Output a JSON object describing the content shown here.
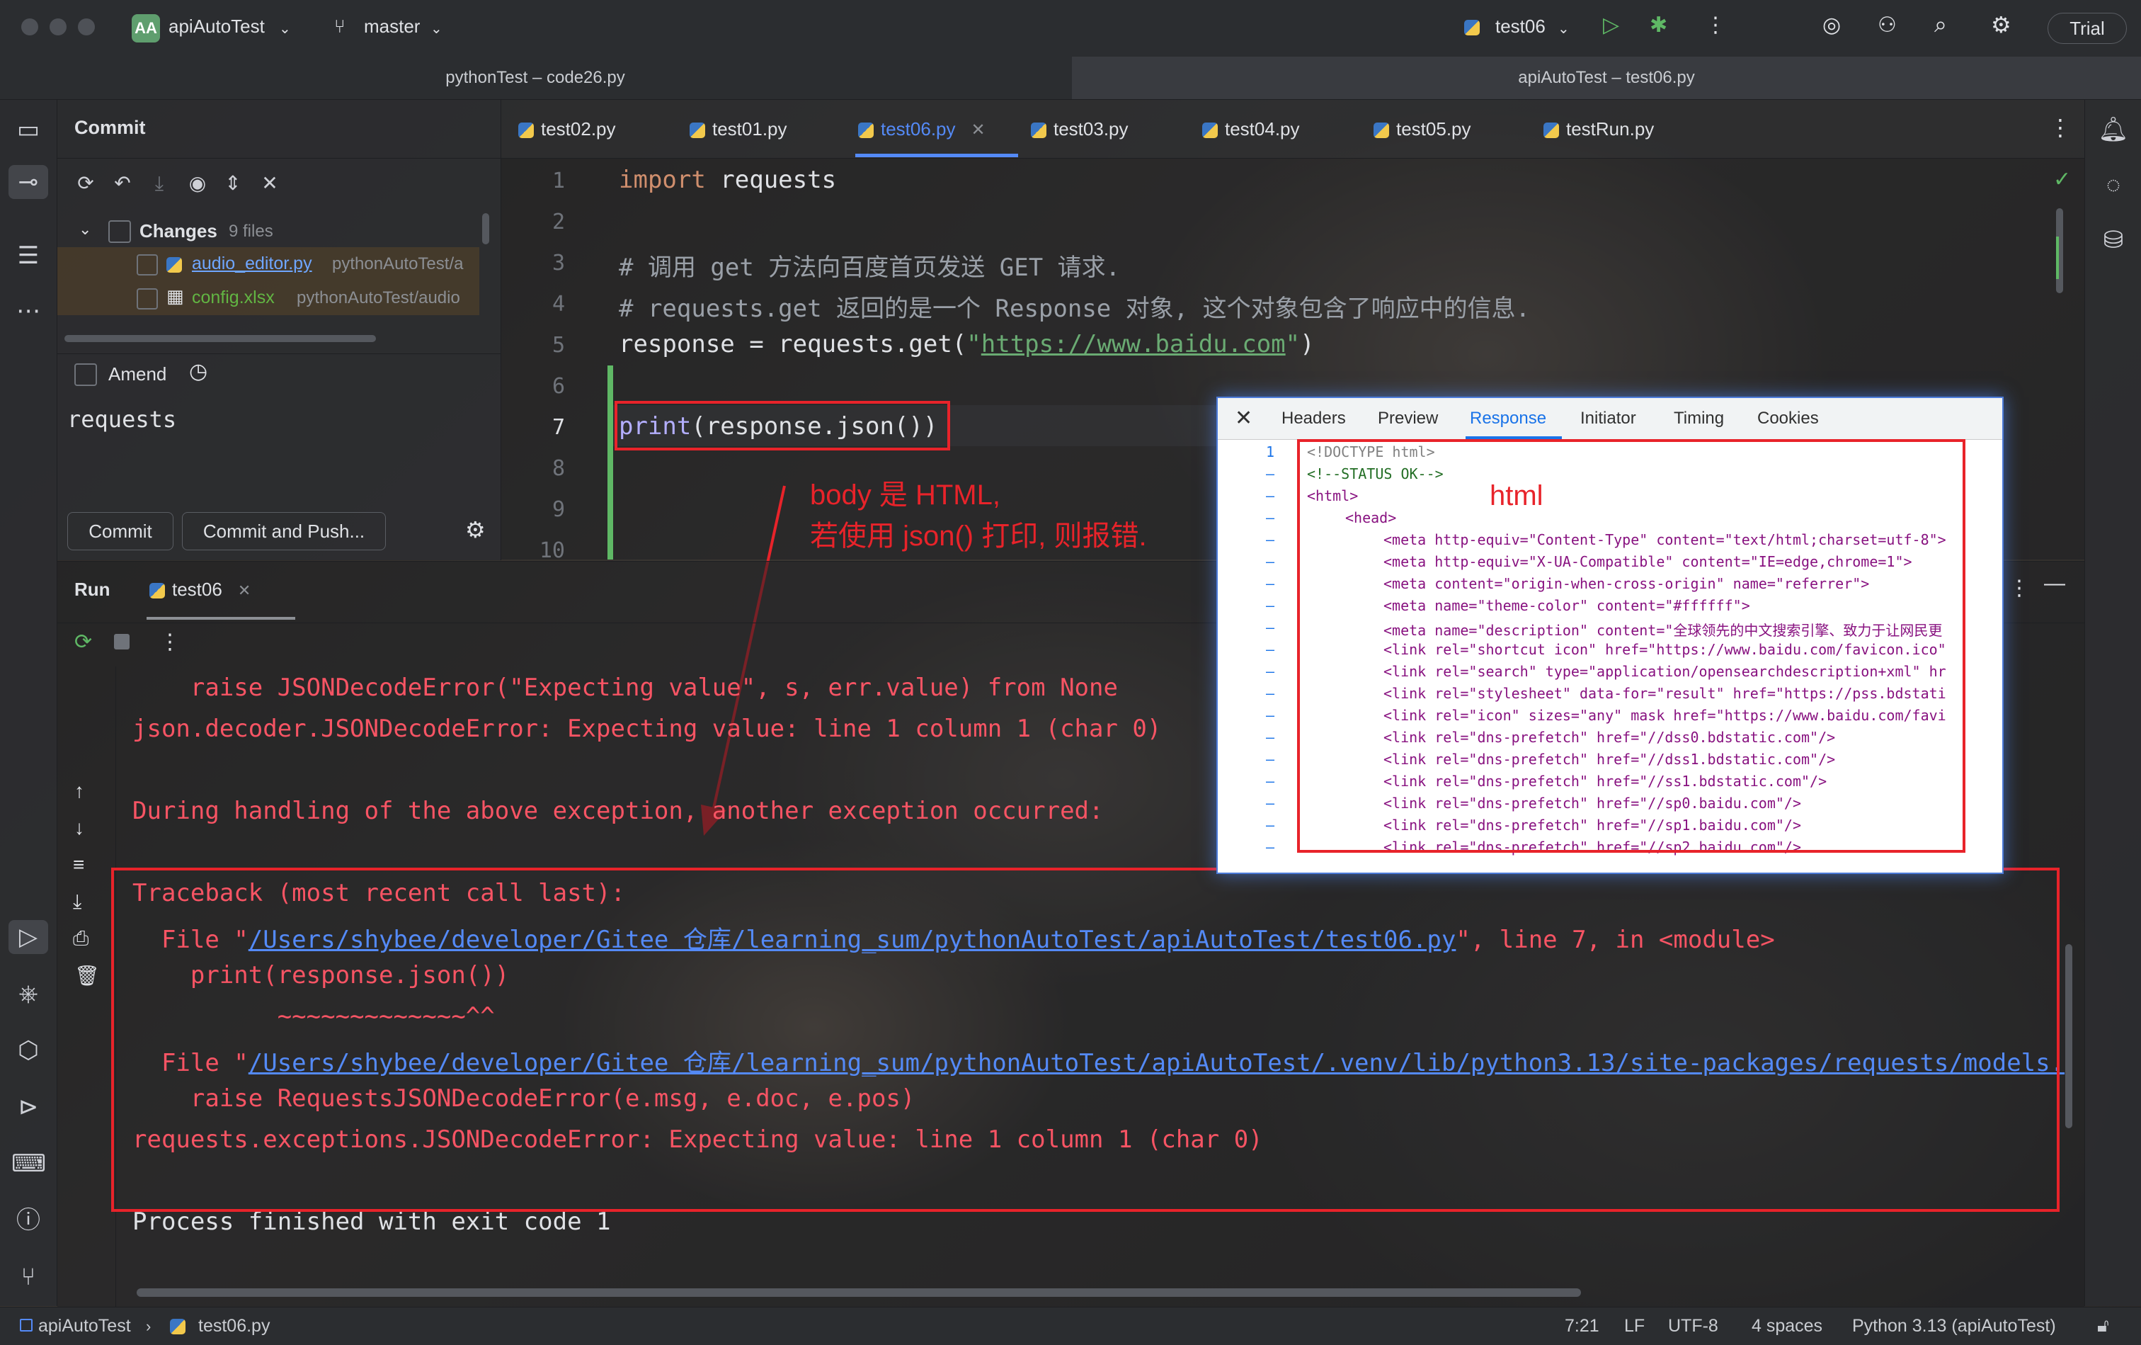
{
  "topbar": {
    "project_badge": "AA",
    "project_name": "apiAutoTest",
    "branch": "master",
    "run_config": "test06",
    "trial_label": "Trial"
  },
  "window_titles": {
    "left": "pythonTest – code26.py",
    "right": "apiAutoTest – test06.py"
  },
  "commit_panel": {
    "title": "Commit",
    "changes_label": "Changes",
    "changes_count": "9 files",
    "files": [
      {
        "name": "audio_editor.py",
        "path": "pythonAutoTest/a"
      },
      {
        "name": "config.xlsx",
        "path": "pythonAutoTest/audio"
      }
    ],
    "amend_label": "Amend",
    "message": "requests",
    "commit_button": "Commit",
    "commit_push_button": "Commit and Push..."
  },
  "editor_tabs": [
    {
      "label": "test02.py"
    },
    {
      "label": "test01.py"
    },
    {
      "label": "test06.py"
    },
    {
      "label": "test03.py"
    },
    {
      "label": "test04.py"
    },
    {
      "label": "test05.py"
    },
    {
      "label": "testRun.py"
    }
  ],
  "editor": {
    "line_numbers": [
      "1",
      "2",
      "3",
      "4",
      "5",
      "6",
      "7",
      "8",
      "9",
      "10"
    ],
    "l1_kw": "import",
    "l1_rest": " requests",
    "l3": "# 调用 get 方法向百度首页发送 GET 请求.",
    "l4": "# requests.get 返回的是一个 Response 对象, 这个对象包含了响应中的信息.",
    "l5_a": "response = requests.get(",
    "l5_q1": "\"",
    "l5_url": "https://www.baidu.com",
    "l5_q2": "\"",
    "l5_b": ")",
    "l7_fn": "print",
    "l7_rest": "(response.json())"
  },
  "annotations": {
    "body_note_1": "body 是 HTML,",
    "body_note_2": "若使用 json() 打印, 则报错.",
    "html_label": "html"
  },
  "run_panel": {
    "title": "Run",
    "tab": "test06",
    "lines": {
      "r1": "    raise JSONDecodeError(\"Expecting value\", s, err.value) from None",
      "r2": "json.decoder.JSONDecodeError: Expecting value: line 1 column 1 (char 0)",
      "r3": "During handling of the above exception, another exception occurred:",
      "r4": "Traceback (most recent call last):",
      "r5_a": "  File \"",
      "r5_link": "/Users/shybee/developer/Gitee 仓库/learning_sum/pythonAutoTest/apiAutoTest/test06.py",
      "r5_b": "\", line 7, in <module>",
      "r6": "    print(response.json())",
      "r7": "          ~~~~~~~~~~~~~^^",
      "r8_a": "  File \"",
      "r8_link": "/Users/shybee/developer/Gitee 仓库/learning_sum/pythonAutoTest/apiAutoTest/.venv/lib/python3.13/site-packages/requests/models.",
      "r9": "    raise RequestsJSONDecodeError(e.msg, e.doc, e.pos)",
      "r10": "requests.exceptions.JSONDecodeError: Expecting value: line 1 column 1 (char 0)",
      "r11": "Process finished with exit code 1"
    }
  },
  "devtools": {
    "tabs": [
      "Headers",
      "Preview",
      "Response",
      "Initiator",
      "Timing",
      "Cookies"
    ],
    "gutter": [
      "1",
      "–",
      "–",
      "–",
      "–",
      "–",
      "–",
      "–",
      "–",
      "–",
      "–",
      "–",
      "–",
      "–",
      "–",
      "–",
      "–",
      "–",
      "–"
    ],
    "lines": [
      {
        "i": 0,
        "c": "<!DOCTYPE html>"
      },
      {
        "i": 0,
        "c": "<!--STATUS OK-->"
      },
      {
        "i": 0,
        "c": "<html>"
      },
      {
        "i": 1,
        "c": "<head>"
      },
      {
        "i": 2,
        "c": "<meta http-equiv=\"Content-Type\" content=\"text/html;charset=utf-8\">"
      },
      {
        "i": 2,
        "c": "<meta http-equiv=\"X-UA-Compatible\" content=\"IE=edge,chrome=1\">"
      },
      {
        "i": 2,
        "c": "<meta content=\"origin-when-cross-origin\" name=\"referrer\">"
      },
      {
        "i": 2,
        "c": "<meta name=\"theme-color\" content=\"#ffffff\">"
      },
      {
        "i": 2,
        "c": "<meta name=\"description\" content=\"全球领先的中文搜索引擎、致力于让网民更"
      },
      {
        "i": 2,
        "c": "<link rel=\"shortcut icon\" href=\"https://www.baidu.com/favicon.ico\""
      },
      {
        "i": 2,
        "c": "<link rel=\"search\" type=\"application/opensearchdescription+xml\" hr"
      },
      {
        "i": 2,
        "c": "<link rel=\"stylesheet\" data-for=\"result\" href=\"https://pss.bdstati"
      },
      {
        "i": 2,
        "c": "<link rel=\"icon\" sizes=\"any\" mask href=\"https://www.baidu.com/favi"
      },
      {
        "i": 2,
        "c": "<link rel=\"dns-prefetch\" href=\"//dss0.bdstatic.com\"/>"
      },
      {
        "i": 2,
        "c": "<link rel=\"dns-prefetch\" href=\"//dss1.bdstatic.com\"/>"
      },
      {
        "i": 2,
        "c": "<link rel=\"dns-prefetch\" href=\"//ss1.bdstatic.com\"/>"
      },
      {
        "i": 2,
        "c": "<link rel=\"dns-prefetch\" href=\"//sp0.baidu.com\"/>"
      },
      {
        "i": 2,
        "c": "<link rel=\"dns-prefetch\" href=\"//sp1.baidu.com\"/>"
      },
      {
        "i": 2,
        "c": "<link rel=\"dns-prefetch\" href=\"//sp2.baidu.com\"/>"
      }
    ]
  },
  "statusbar": {
    "project": "apiAutoTest",
    "file": "test06.py",
    "position": "7:21",
    "line_sep": "LF",
    "encoding": "UTF-8",
    "indent": "4 spaces",
    "interpreter": "Python 3.13 (apiAutoTest)"
  },
  "colors": {
    "error": "#f75464",
    "link": "#548af7",
    "annotation": "#e8232a",
    "active_tab": "#548af7"
  }
}
